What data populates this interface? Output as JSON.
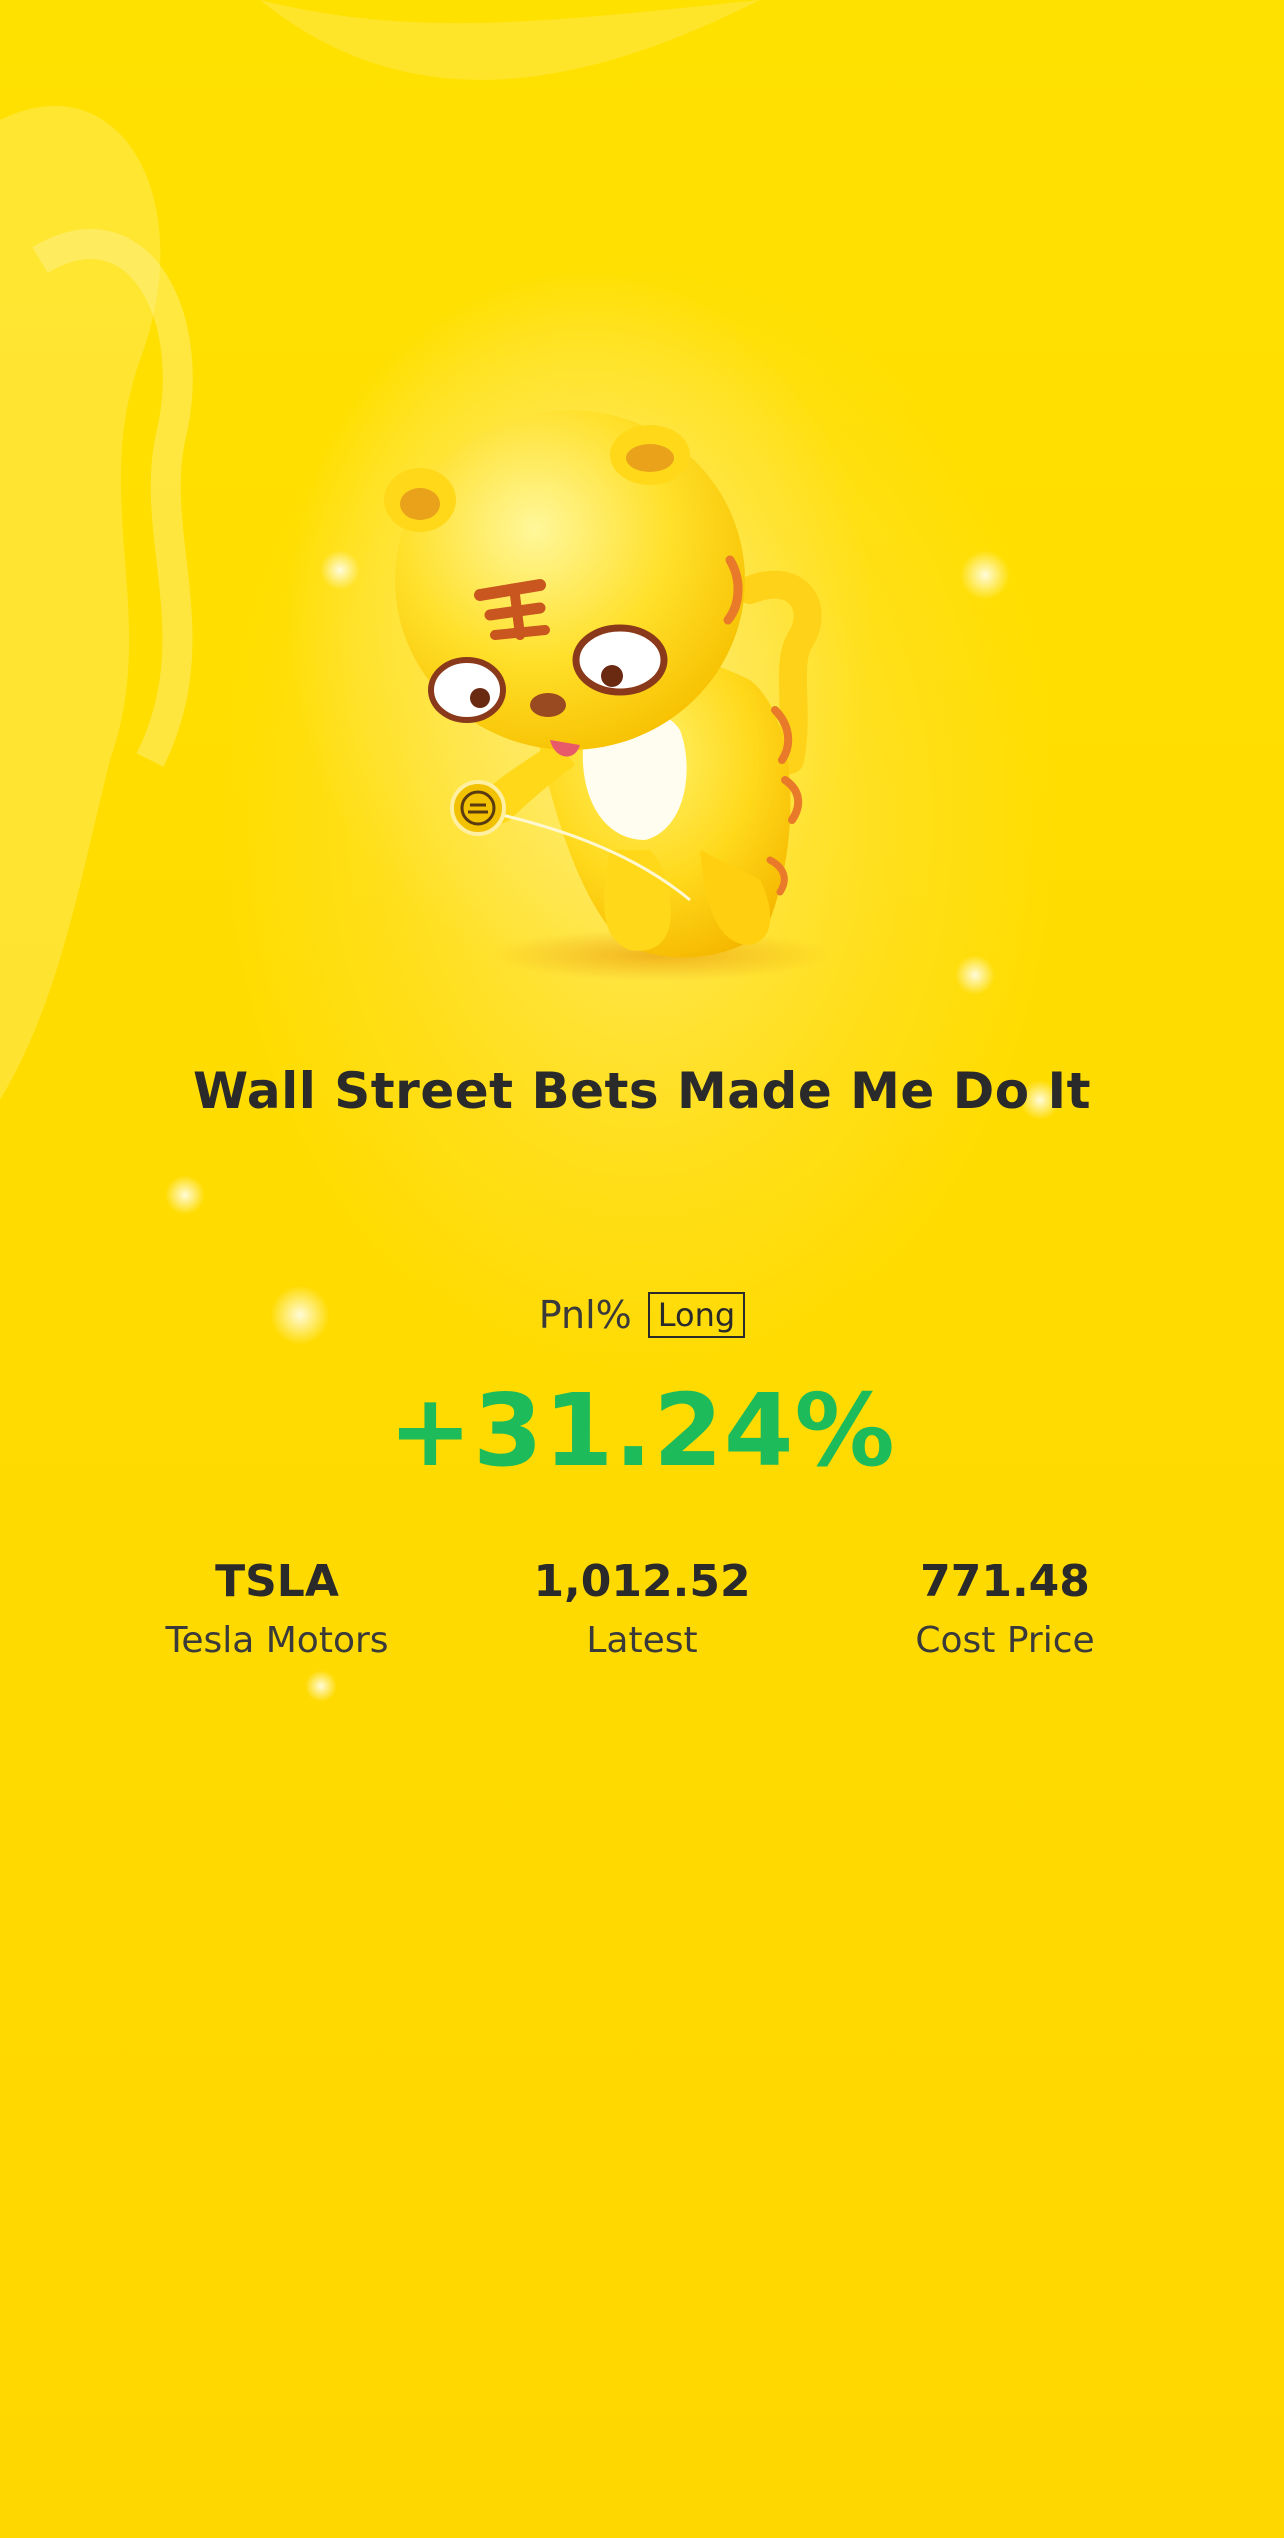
{
  "title": "Wall Street Bets Made Me Do It",
  "pnl": {
    "label": "Pnl%",
    "badge": "Long",
    "value": "+31.24%"
  },
  "stats": [
    {
      "value": "TSLA",
      "label": "Tesla Motors"
    },
    {
      "value": "1,012.52",
      "label": "Latest"
    },
    {
      "value": "771.48",
      "label": "Cost Price"
    }
  ],
  "colors": {
    "background": "#FFD800",
    "positive": "#1DBB5A",
    "text": "#2a2a2a"
  },
  "mascot": {
    "icon": "tiger-mascot-with-yoyo-icon"
  }
}
